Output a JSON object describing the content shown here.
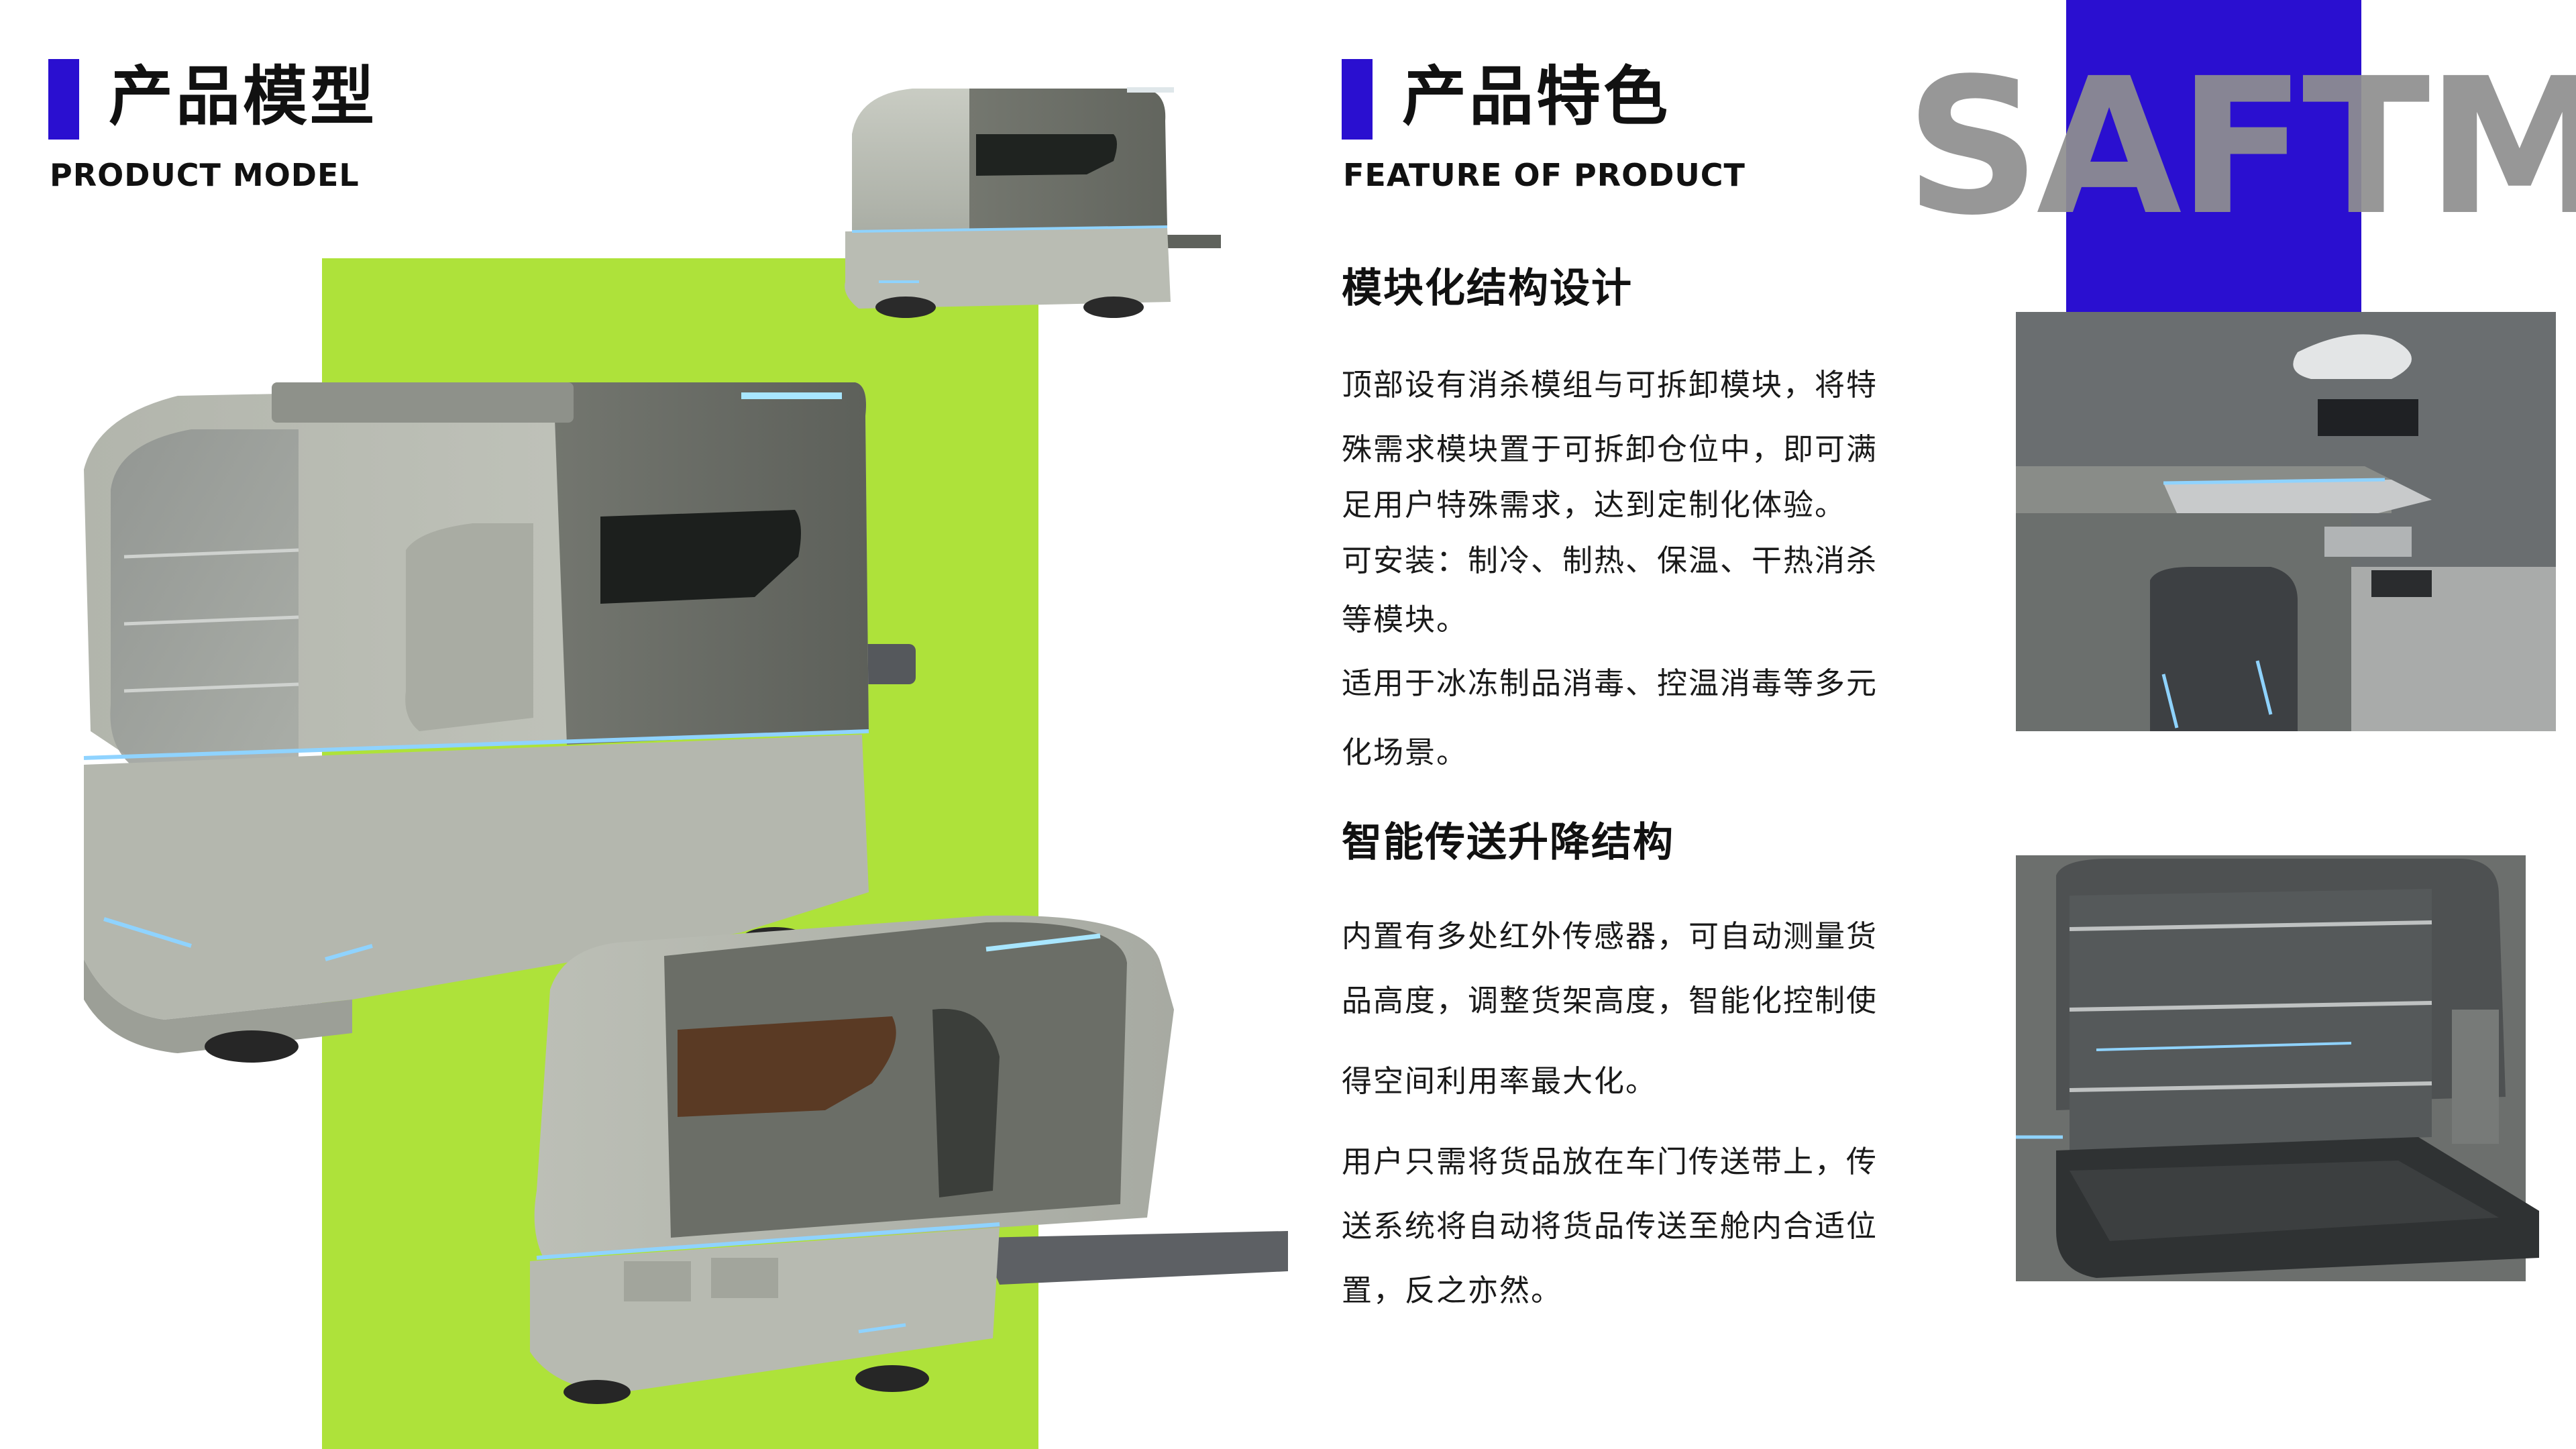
{
  "brand": {
    "text": "SAFTMI",
    "accent_color": "#2a0fd0"
  },
  "section_model": {
    "title": "产品模型",
    "subtitle": "PRODUCT MODEL"
  },
  "section_feature": {
    "title": "产品特色",
    "subtitle": "FEATURE OF PRODUCT"
  },
  "features": [
    {
      "heading": "模块化结构设计",
      "lines": [
        "顶部设有消杀模组与可拆卸模块，将特",
        "殊需求模块置于可拆卸仓位中，即可满",
        "足用户特殊需求，达到定制化体验。",
        "可安装：制冷、制热、保温、干热消杀",
        "等模块。",
        "适用于冰冻制品消毒、控温消毒等多元",
        "化场景。"
      ]
    },
    {
      "heading": "智能传送升降结构",
      "lines": [
        "内置有多处红外传感器，可自动测量货",
        "品高度，调整货架高度，智能化控制使",
        "得空间利用率最大化。",
        "用户只需将货品放在车门传送带上，传",
        "送系统将自动将货品传送至舱内合适位",
        "置，反之亦然。"
      ]
    }
  ],
  "colors": {
    "green_panel": "#aee23a",
    "brand_text": "#8f8f8f"
  }
}
